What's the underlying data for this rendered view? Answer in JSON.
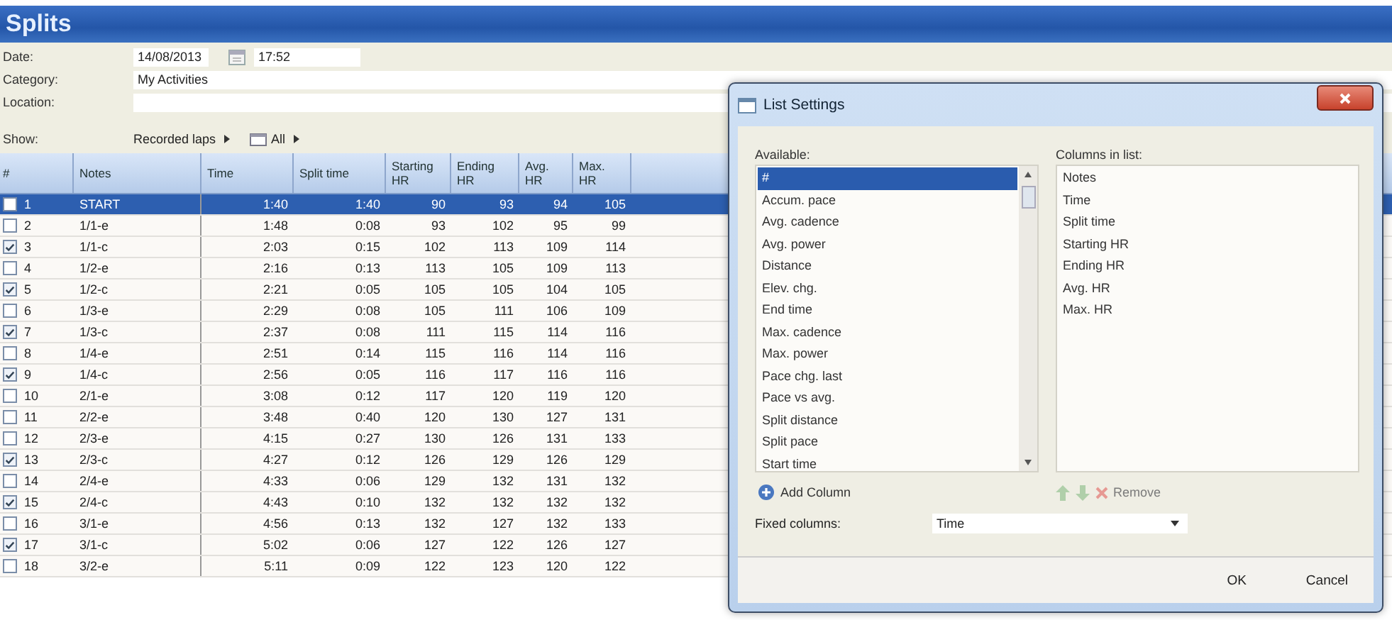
{
  "window": {
    "title": "Splits"
  },
  "form": {
    "fields": [
      {
        "label": "Date:",
        "kind": "datetime",
        "value": "14/08/2013",
        "time": "17:52"
      },
      {
        "label": "Category:",
        "kind": "text",
        "value": "My Activities"
      },
      {
        "label": "Location:",
        "kind": "text"
      }
    ],
    "show": {
      "label": "Show:",
      "laps_menu": "Recorded laps",
      "filter_menu": "All"
    }
  },
  "table": {
    "columns": [
      "#",
      "Notes",
      "Time",
      "Split time",
      "Starting HR",
      "Ending HR",
      "Avg. HR",
      "Max. HR"
    ],
    "rows": [
      {
        "checked": false,
        "selected": true,
        "cells": [
          "1",
          "START",
          "1:40",
          "1:40",
          "90",
          "93",
          "94",
          "105"
        ]
      },
      {
        "checked": false,
        "selected": false,
        "cells": [
          "2",
          "1/1-e",
          "1:48",
          "0:08",
          "93",
          "102",
          "95",
          "99"
        ]
      },
      {
        "checked": true,
        "selected": false,
        "cells": [
          "3",
          "1/1-c",
          "2:03",
          "0:15",
          "102",
          "113",
          "109",
          "114"
        ]
      },
      {
        "checked": false,
        "selected": false,
        "cells": [
          "4",
          "1/2-e",
          "2:16",
          "0:13",
          "113",
          "105",
          "109",
          "113"
        ]
      },
      {
        "checked": true,
        "selected": false,
        "cells": [
          "5",
          "1/2-c",
          "2:21",
          "0:05",
          "105",
          "105",
          "104",
          "105"
        ]
      },
      {
        "checked": false,
        "selected": false,
        "cells": [
          "6",
          "1/3-e",
          "2:29",
          "0:08",
          "105",
          "111",
          "106",
          "109"
        ]
      },
      {
        "checked": true,
        "selected": false,
        "cells": [
          "7",
          "1/3-c",
          "2:37",
          "0:08",
          "111",
          "115",
          "114",
          "116"
        ]
      },
      {
        "checked": false,
        "selected": false,
        "cells": [
          "8",
          "1/4-e",
          "2:51",
          "0:14",
          "115",
          "116",
          "114",
          "116"
        ]
      },
      {
        "checked": true,
        "selected": false,
        "cells": [
          "9",
          "1/4-c",
          "2:56",
          "0:05",
          "116",
          "117",
          "116",
          "116"
        ]
      },
      {
        "checked": false,
        "selected": false,
        "cells": [
          "10",
          "2/1-e",
          "3:08",
          "0:12",
          "117",
          "120",
          "119",
          "120"
        ]
      },
      {
        "checked": false,
        "selected": false,
        "cells": [
          "11",
          "2/2-e",
          "3:48",
          "0:40",
          "120",
          "130",
          "127",
          "131"
        ]
      },
      {
        "checked": false,
        "selected": false,
        "cells": [
          "12",
          "2/3-e",
          "4:15",
          "0:27",
          "130",
          "126",
          "131",
          "133"
        ]
      },
      {
        "checked": true,
        "selected": false,
        "cells": [
          "13",
          "2/3-c",
          "4:27",
          "0:12",
          "126",
          "129",
          "126",
          "129"
        ]
      },
      {
        "checked": false,
        "selected": false,
        "cells": [
          "14",
          "2/4-e",
          "4:33",
          "0:06",
          "129",
          "132",
          "131",
          "132"
        ]
      },
      {
        "checked": true,
        "selected": false,
        "cells": [
          "15",
          "2/4-c",
          "4:43",
          "0:10",
          "132",
          "132",
          "132",
          "132"
        ]
      },
      {
        "checked": false,
        "selected": false,
        "cells": [
          "16",
          "3/1-e",
          "4:56",
          "0:13",
          "132",
          "127",
          "132",
          "133"
        ]
      },
      {
        "checked": true,
        "selected": false,
        "cells": [
          "17",
          "3/1-c",
          "5:02",
          "0:06",
          "127",
          "122",
          "126",
          "127"
        ]
      },
      {
        "checked": false,
        "selected": false,
        "cells": [
          "18",
          "3/2-e",
          "5:11",
          "0:09",
          "122",
          "123",
          "120",
          "122"
        ]
      }
    ]
  },
  "dialog": {
    "title": "List Settings",
    "available_label": "Available:",
    "columns_label": "Columns in list:",
    "available": [
      {
        "label": "#",
        "selected": true
      },
      {
        "label": "Accum. pace",
        "selected": false
      },
      {
        "label": "Avg. cadence",
        "selected": false
      },
      {
        "label": "Avg. power",
        "selected": false
      },
      {
        "label": "Distance",
        "selected": false
      },
      {
        "label": "Elev. chg.",
        "selected": false
      },
      {
        "label": "End time",
        "selected": false
      },
      {
        "label": "Max. cadence",
        "selected": false
      },
      {
        "label": "Max. power",
        "selected": false
      },
      {
        "label": "Pace chg. last",
        "selected": false
      },
      {
        "label": "Pace vs avg.",
        "selected": false
      },
      {
        "label": "Split distance",
        "selected": false
      },
      {
        "label": "Split pace",
        "selected": false
      },
      {
        "label": "Start time",
        "selected": false
      }
    ],
    "columns": [
      "Notes",
      "Time",
      "Split time",
      "Starting HR",
      "Ending HR",
      "Avg. HR",
      "Max. HR"
    ],
    "actions": [
      {
        "kind": "add",
        "label": "Add Column",
        "disabled": false
      },
      {
        "kind": "up",
        "disabled": true
      },
      {
        "kind": "down",
        "disabled": true
      },
      {
        "kind": "remove",
        "label": "Remove",
        "disabled": true
      }
    ],
    "fixed": {
      "label": "Fixed columns:",
      "value": "Time"
    },
    "buttons": [
      "OK",
      "Cancel"
    ]
  }
}
